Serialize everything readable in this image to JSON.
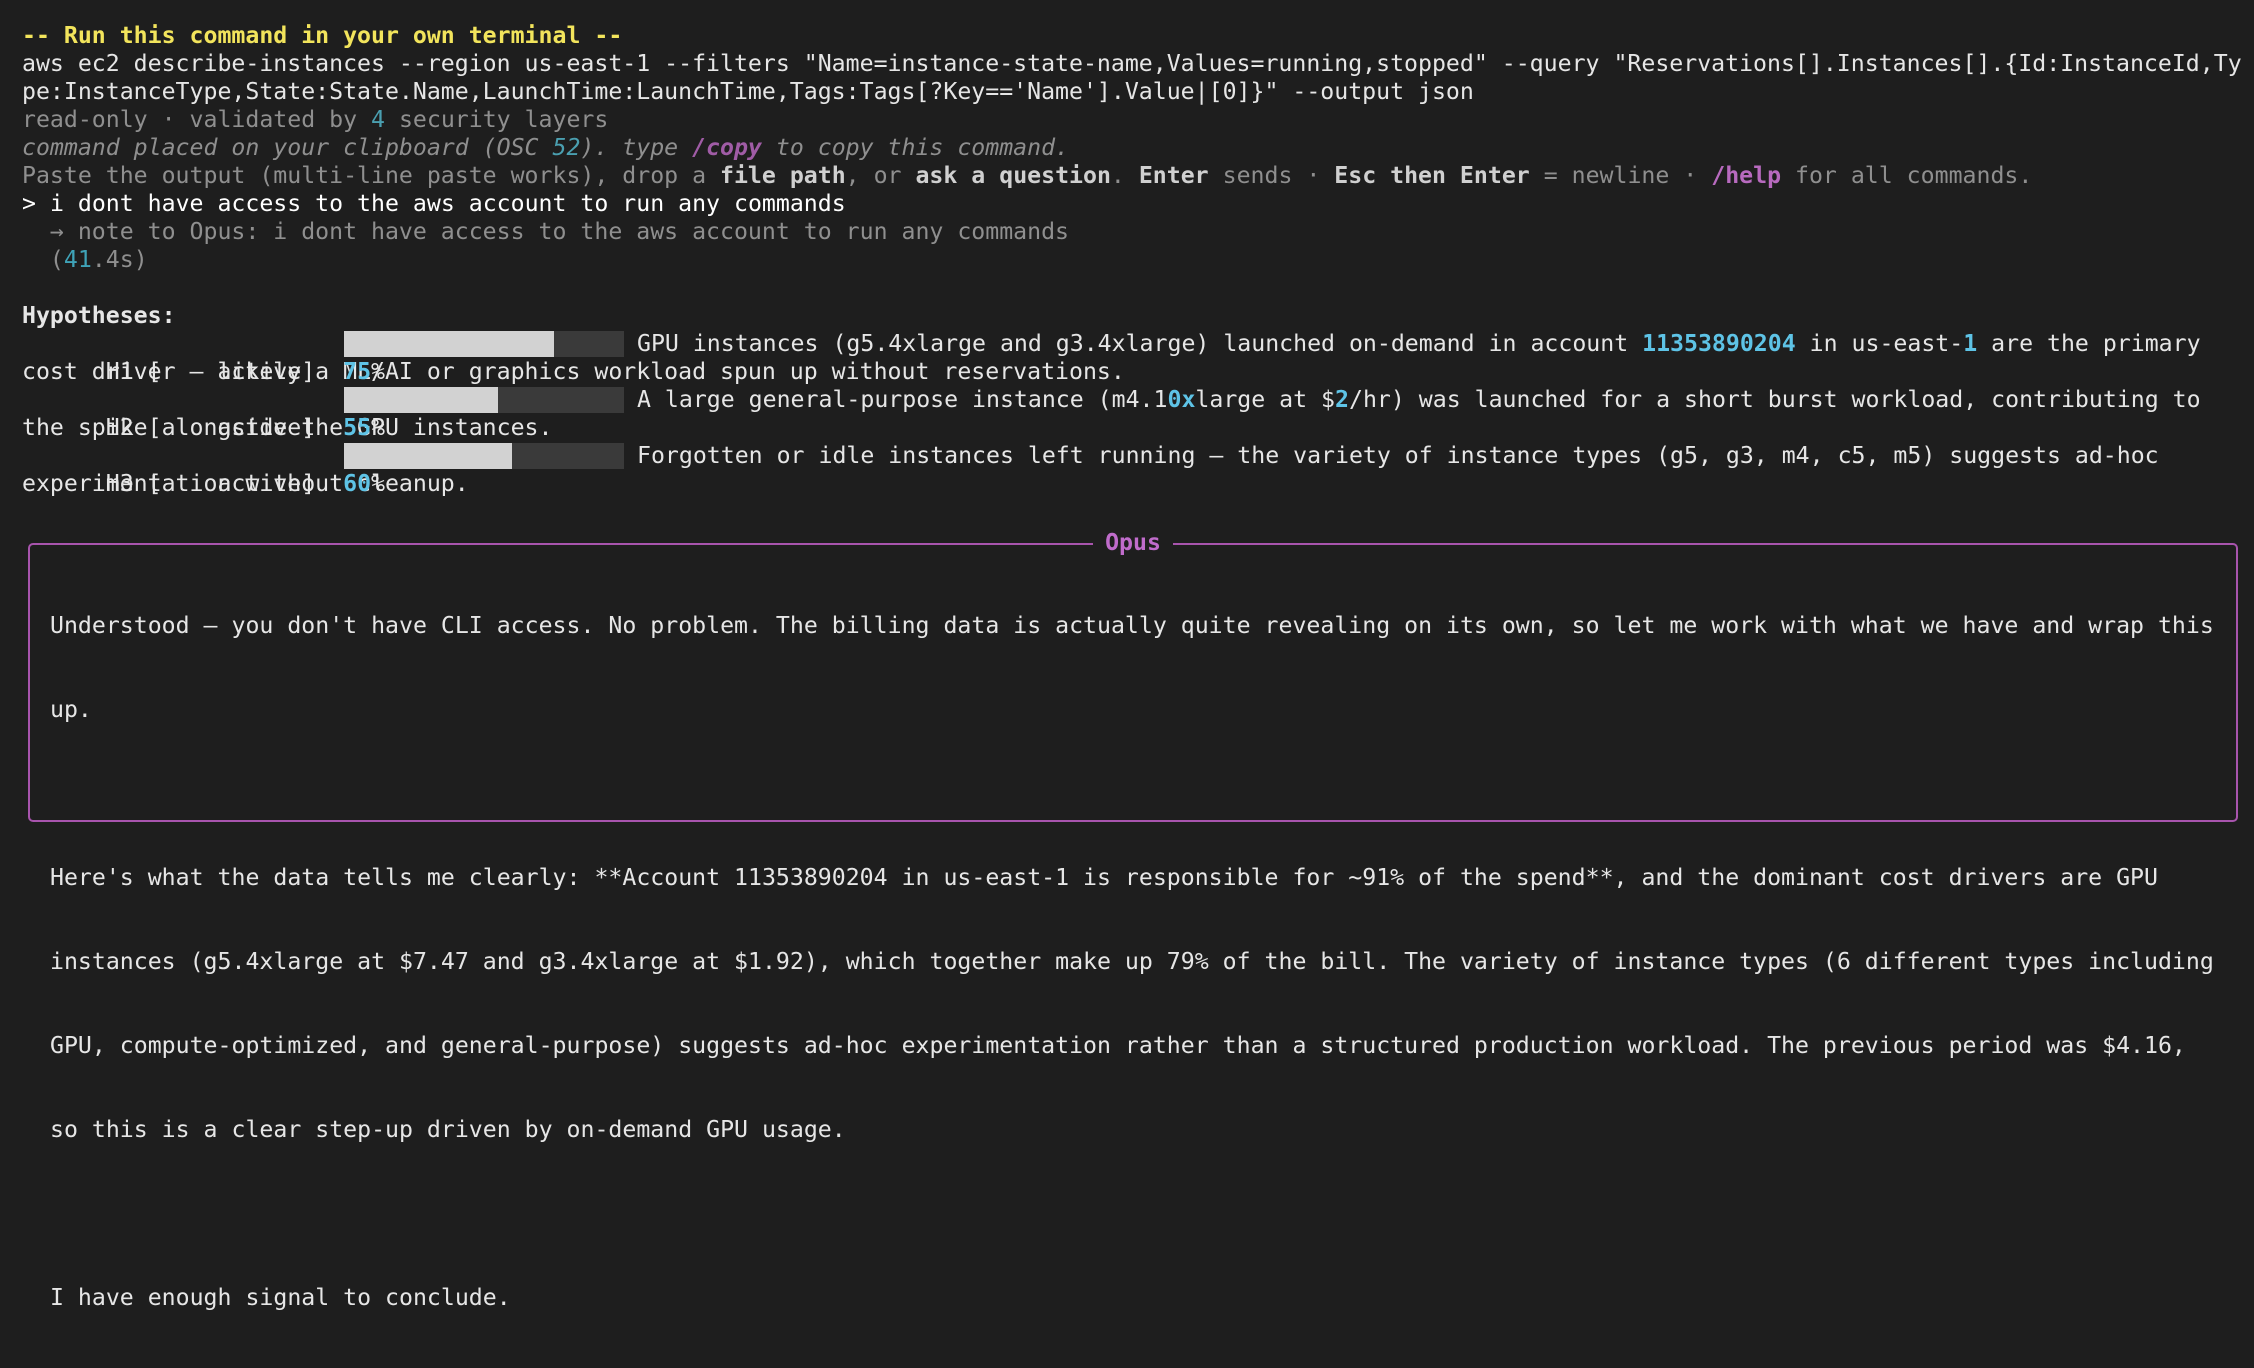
{
  "header": {
    "run_command_title": "-- Run this command in your own terminal --"
  },
  "command": {
    "line1": "aws ec2 describe-instances --region us-east-1 --filters \"Name=instance-state-name,Values=running,stopped\" --query \"Reservations[].Instances[].{Id:InstanceId,Ty",
    "line2": "pe:InstanceType,State:State.Name,LaunchTime:LaunchTime,Tags:Tags[?Key=='Name'].Value|[0]}\" --output json"
  },
  "validation": {
    "prefix": "read-only · validated by ",
    "count": "4",
    "suffix": " security layers"
  },
  "clipboard": {
    "prefix": "command placed on your clipboard (OSC ",
    "osc_number": "52",
    "middle": "). type ",
    "copy_cmd": "/copy",
    "suffix": " to copy this command."
  },
  "instructions": {
    "part1": "Paste the output (multi-line paste works), drop a ",
    "file_path": "file path",
    "part2": ", or ",
    "ask": "ask a question",
    "part3": ". ",
    "enter": "Enter",
    "part4": " sends · ",
    "esc_enter": "Esc then Enter",
    "part5": " = newline · ",
    "help_cmd": "/help",
    "part6": " for all commands."
  },
  "user_input": {
    "prompt_symbol": ">",
    "text": "i dont have access to the aws account to run any commands",
    "note": "→ note to Opus: i dont have access to the aws account to run any commands",
    "elapsed_open": "(",
    "elapsed_int": "41",
    "elapsed_rest": ".4s)"
  },
  "hypotheses": {
    "title": "Hypotheses:",
    "items": [
      {
        "id": "H1",
        "status": "active",
        "percent": "75",
        "percent_sign": "%",
        "level": 0.75,
        "desc_a": "GPU instances (g5.4xlarge and g3.4xlarge) launched on-demand in account ",
        "account": "11353890204",
        "desc_b": " in us-east-",
        "region_num": "1",
        "desc_c": " are the primary",
        "desc_line2": "cost driver — likely a ML/AI or graphics workload spun up without reservations."
      },
      {
        "id": "H2",
        "status": "active",
        "percent": "55",
        "percent_sign": "%",
        "level": 0.55,
        "desc_a": "A large general-purpose instance (m4.1",
        "hl1": "0x",
        "desc_b": "large at $",
        "hl2": "2",
        "desc_c": "/hr) was launched for a short burst workload, contributing to",
        "desc_line2": "the spike alongside the GPU instances."
      },
      {
        "id": "H3",
        "status": "active",
        "percent": "60",
        "percent_sign": "%",
        "level": 0.6,
        "desc_a": "Forgotten or idle instances left running — the variety of instance types (g5, g3, m4, c5, m5) suggests ad-hoc",
        "desc_line2": "experimentation without cleanup."
      }
    ]
  },
  "opus": {
    "title": "Opus",
    "lines": [
      "Understood — you don't have CLI access. No problem. The billing data is actually quite revealing on its own, so let me work with what we have and wrap this",
      "up.",
      "",
      "Here's what the data tells me clearly: **Account 11353890204 in us-east-1 is responsible for ~91% of the spend**, and the dominant cost drivers are GPU",
      "instances (g5.4xlarge at $7.47 and g3.4xlarge at $1.92), which together make up 79% of the bill. The variety of instance types (6 different types including",
      "GPU, compute-optimized, and general-purpose) suggests ad-hoc experimentation rather than a structured production workload. The previous period was $4.16,",
      "so this is a clear step-up driven by on-demand GPU usage.",
      "",
      "I have enough signal to conclude."
    ]
  },
  "colors": {
    "background": "#1e1e1e",
    "title_yellow": "#f2e45c",
    "accent_cyan": "#5ec3e6",
    "opus_purple": "#a854ad",
    "bar_fill": "#d2d2d2"
  }
}
